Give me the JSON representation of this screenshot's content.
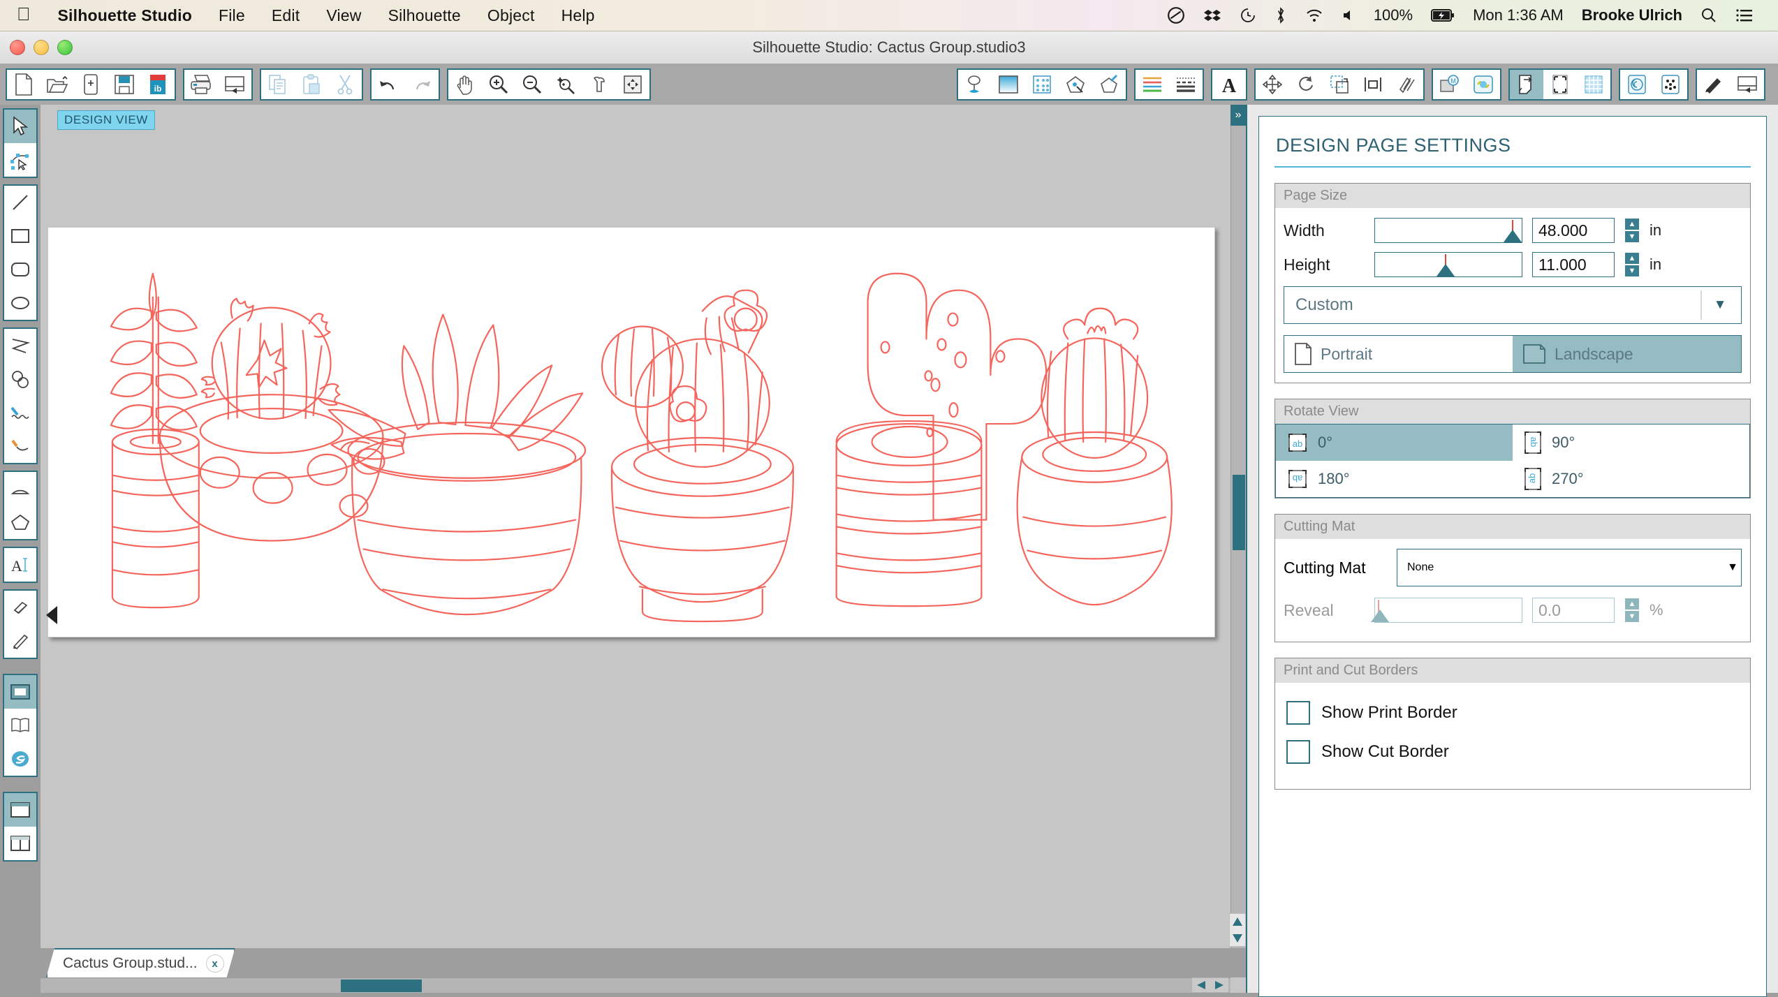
{
  "menubar": {
    "apple_icon": "apple-icon",
    "app_name": "Silhouette Studio",
    "items": [
      "File",
      "Edit",
      "View",
      "Silhouette",
      "Object",
      "Help"
    ],
    "status": {
      "battery_percent": "100%",
      "clock": "Mon 1:36 AM",
      "user": "Brooke Ulrich",
      "icons": [
        "creative-cloud-icon",
        "dropbox-icon",
        "time-machine-icon",
        "bluetooth-icon",
        "wifi-icon",
        "volume-icon",
        "battery-charging-icon",
        "spotlight-search-icon",
        "notification-center-icon"
      ]
    }
  },
  "titlebar": {
    "title": "Silhouette Studio: Cactus Group.studio3"
  },
  "toolbar": {
    "groups": [
      {
        "name": "file",
        "buttons": [
          {
            "name": "new-document-icon",
            "label": "New"
          },
          {
            "name": "open-document-icon",
            "label": "Open"
          },
          {
            "name": "new-from-template-icon",
            "label": "New From Template"
          },
          {
            "name": "save-icon",
            "label": "Save"
          },
          {
            "name": "save-to-library-icon",
            "label": "Save To Library"
          }
        ]
      },
      {
        "name": "print",
        "buttons": [
          {
            "name": "print-icon",
            "label": "Print"
          },
          {
            "name": "send-to-silhouette-icon",
            "label": "Send"
          }
        ]
      },
      {
        "name": "clipboard",
        "buttons": [
          {
            "name": "copy-icon",
            "label": "Copy"
          },
          {
            "name": "paste-icon",
            "label": "Paste"
          },
          {
            "name": "cut-scissors-icon",
            "label": "Cut"
          }
        ]
      },
      {
        "name": "history",
        "buttons": [
          {
            "name": "undo-icon",
            "label": "Undo"
          },
          {
            "name": "redo-icon",
            "label": "Redo"
          }
        ]
      },
      {
        "name": "view",
        "buttons": [
          {
            "name": "pan-hand-icon",
            "label": "Pan"
          },
          {
            "name": "zoom-in-icon",
            "label": "Zoom In"
          },
          {
            "name": "zoom-out-icon",
            "label": "Zoom Out"
          },
          {
            "name": "zoom-selection-icon",
            "label": "Zoom Selection"
          },
          {
            "name": "zoom-region-icon",
            "label": "Zoom Region"
          },
          {
            "name": "fit-to-window-icon",
            "label": "Fit To Window"
          }
        ]
      },
      {
        "name": "style",
        "buttons": [
          {
            "name": "fill-color-icon",
            "label": "Fill Color"
          },
          {
            "name": "fill-gradient-icon",
            "label": "Fill Gradient"
          },
          {
            "name": "fill-pattern-icon",
            "label": "Fill Pattern"
          },
          {
            "name": "line-color-icon",
            "label": "Line Color"
          },
          {
            "name": "sketch-pen-icon",
            "label": "Sketch Pen"
          }
        ]
      },
      {
        "name": "lines",
        "buttons": [
          {
            "name": "line-style-icon",
            "label": "Line Style"
          },
          {
            "name": "line-thickness-icon",
            "label": "Line Thickness"
          }
        ]
      },
      {
        "name": "text",
        "buttons": [
          {
            "name": "text-style-icon",
            "label": "Text Style"
          }
        ]
      },
      {
        "name": "transform",
        "buttons": [
          {
            "name": "move-transform-icon",
            "label": "Move"
          },
          {
            "name": "rotate-icon",
            "label": "Rotate"
          },
          {
            "name": "scale-icon",
            "label": "Scale"
          },
          {
            "name": "align-icon",
            "label": "Align"
          },
          {
            "name": "replicate-icon",
            "label": "Replicate"
          }
        ]
      },
      {
        "name": "objects",
        "buttons": [
          {
            "name": "modify-icon",
            "label": "Modify"
          },
          {
            "name": "offset-icon",
            "label": "Offset"
          }
        ]
      },
      {
        "name": "page",
        "buttons": [
          {
            "name": "design-page-settings-icon",
            "label": "Design Page Settings",
            "active": true
          },
          {
            "name": "registration-marks-icon",
            "label": "Registration Marks"
          },
          {
            "name": "grid-settings-icon",
            "label": "Grid Settings"
          }
        ]
      },
      {
        "name": "effects",
        "buttons": [
          {
            "name": "knife-spiral-icon",
            "label": "Knife"
          },
          {
            "name": "rhinestones-icon",
            "label": "Rhinestones"
          }
        ]
      },
      {
        "name": "cut",
        "buttons": [
          {
            "name": "cut-settings-icon",
            "label": "Cut Settings"
          },
          {
            "name": "send-panel-icon",
            "label": "Send"
          }
        ]
      }
    ]
  },
  "tools": {
    "groups": [
      {
        "name": "selection",
        "items": [
          {
            "name": "select-arrow-tool",
            "label": "Select",
            "active": true
          },
          {
            "name": "edit-points-tool",
            "label": "Edit Points"
          }
        ]
      },
      {
        "name": "shapes",
        "items": [
          {
            "name": "line-tool",
            "label": "Draw a Line"
          },
          {
            "name": "rectangle-tool",
            "label": "Draw a Rectangle"
          },
          {
            "name": "rounded-rectangle-tool",
            "label": "Draw a Rounded Rectangle"
          },
          {
            "name": "ellipse-tool",
            "label": "Draw an Ellipse"
          }
        ]
      },
      {
        "name": "draw",
        "items": [
          {
            "name": "polygon-tool",
            "label": "Draw a Polygon"
          },
          {
            "name": "curve-tool",
            "label": "Draw a Curve Shape"
          },
          {
            "name": "freehand-tool",
            "label": "Draw Freehand"
          },
          {
            "name": "smooth-freehand-tool",
            "label": "Draw Smooth Freehand"
          }
        ]
      },
      {
        "name": "arcs",
        "items": [
          {
            "name": "arc-tool",
            "label": "Draw an Arc"
          },
          {
            "name": "regular-polygon-tool",
            "label": "Draw a Regular Polygon"
          }
        ]
      },
      {
        "name": "text",
        "items": [
          {
            "name": "text-tool",
            "label": "Draw a Text"
          }
        ]
      },
      {
        "name": "edit",
        "items": [
          {
            "name": "eraser-tool",
            "label": "Eraser"
          },
          {
            "name": "knife-tool",
            "label": "Knife"
          }
        ]
      },
      {
        "name": "panels",
        "items": [
          {
            "name": "design-panel-icon",
            "label": "Design",
            "active": true
          },
          {
            "name": "library-panel-icon",
            "label": "Library"
          },
          {
            "name": "store-panel-icon",
            "label": "Silhouette Store"
          }
        ]
      },
      {
        "name": "layouts",
        "items": [
          {
            "name": "single-view-layout-icon",
            "label": "Single View",
            "active": true
          },
          {
            "name": "split-view-layout-icon",
            "label": "Split View"
          }
        ]
      }
    ]
  },
  "canvas": {
    "view_badge": "DESIGN VIEW",
    "artwork": {
      "name": "Cactus Group",
      "stroke_color": "#f4655c",
      "items": [
        "tall-leaf-plant-in-cylinder-pot",
        "round-cactus-in-polka-dot-pot",
        "agave-succulent-in-striped-bowl",
        "double-barrel-cactus-with-flowers",
        "saguaro-cactus-in-ribbed-pot",
        "ribbed-cactus-with-flower-in-round-pot"
      ]
    },
    "expand_panel_label": "»"
  },
  "doctab": {
    "label": "Cactus Group.stud...",
    "close": "x"
  },
  "panel": {
    "title": "DESIGN PAGE SETTINGS",
    "page_size": {
      "header": "Page Size",
      "width_label": "Width",
      "width_value": "48.000",
      "width_unit": "in",
      "height_label": "Height",
      "height_value": "11.000",
      "height_unit": "in",
      "preset": "Custom",
      "orientation": [
        {
          "label": "Portrait",
          "icon": "portrait-page-icon",
          "active": false
        },
        {
          "label": "Landscape",
          "icon": "landscape-page-icon",
          "active": true
        }
      ]
    },
    "rotate_view": {
      "header": "Rotate View",
      "options": [
        {
          "label": "0°",
          "icon": "rotate-0-icon",
          "active": true
        },
        {
          "label": "90°",
          "icon": "rotate-90-icon",
          "active": false
        },
        {
          "label": "180°",
          "icon": "rotate-180-icon",
          "active": false
        },
        {
          "label": "270°",
          "icon": "rotate-270-icon",
          "active": false
        }
      ]
    },
    "cutting_mat": {
      "header": "Cutting Mat",
      "label": "Cutting Mat",
      "value": "None",
      "reveal_label": "Reveal",
      "reveal_value": "0.0",
      "reveal_unit": "%"
    },
    "borders": {
      "header": "Print and Cut Borders",
      "print_border": "Show Print Border",
      "cut_border": "Show Cut Border"
    }
  },
  "colors": {
    "accent": "#2d7080",
    "active": "#95bbc3",
    "artwork": "#f4655c",
    "badge": "#7fd4ee"
  }
}
